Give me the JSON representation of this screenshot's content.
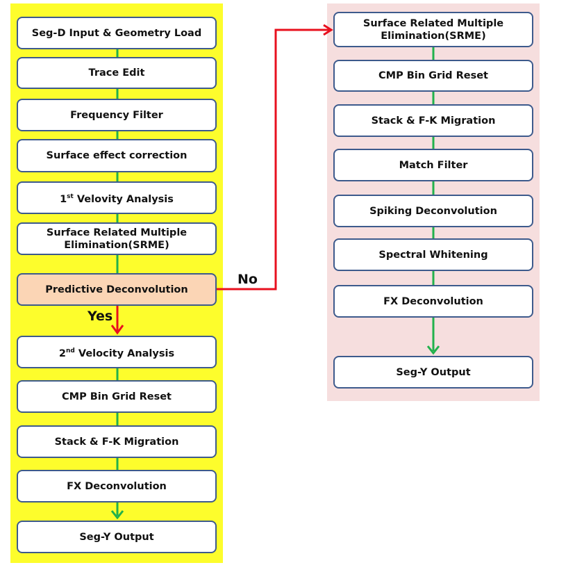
{
  "colors": {
    "left_panel": "#fdfd2c",
    "right_panel": "#f6dede",
    "box_border": "#3d5a8c",
    "highlight": "#fbd5b5",
    "connector": "#22b14c",
    "decision_arrow": "#e8101e"
  },
  "left_flow": [
    {
      "label": "Seg-D Input & Geometry Load"
    },
    {
      "label": "Trace Edit"
    },
    {
      "label": "Frequency Filter"
    },
    {
      "label": "Surface effect correction"
    },
    {
      "pre": "1",
      "sup": "st",
      "label": " Velovity Analysis"
    },
    {
      "label": "Surface Related Multiple Elimination(SRME)"
    },
    {
      "label": "Predictive Deconvolution"
    },
    {
      "pre": "2",
      "sup": "nd",
      "label": " Velocity Analysis"
    },
    {
      "label": "CMP Bin Grid Reset"
    },
    {
      "label": "Stack & F-K Migration"
    },
    {
      "label": "FX Deconvolution"
    },
    {
      "label": "Seg-Y Output"
    }
  ],
  "right_flow": [
    {
      "label": "Surface Related Multiple Elimination(SRME)"
    },
    {
      "label": "CMP Bin Grid Reset"
    },
    {
      "label": "Stack & F-K Migration"
    },
    {
      "label": "Match Filter"
    },
    {
      "label": "Spiking Deconvolution"
    },
    {
      "label": "Spectral Whitening"
    },
    {
      "label": "FX Deconvolution"
    },
    {
      "label": "Seg-Y Output"
    }
  ],
  "decision": {
    "yes": "Yes",
    "no": "No"
  }
}
